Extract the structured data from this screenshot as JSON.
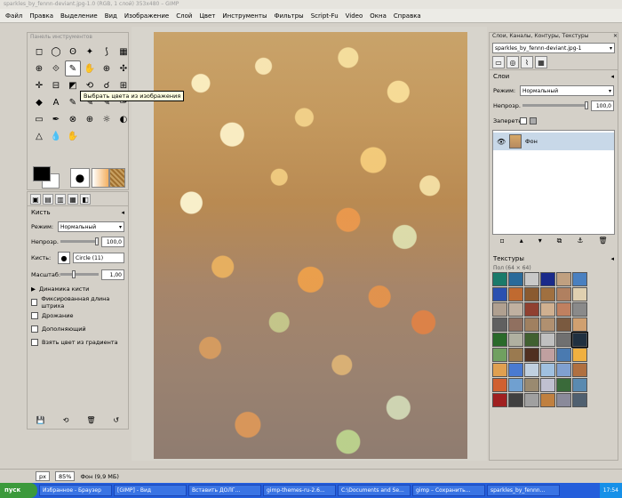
{
  "window": {
    "title": "sparkles_by_fennn-deviant.jpg-1.0 (RGB, 1 слой) 353x480 – GIMP"
  },
  "menu": [
    "Файл",
    "Правка",
    "Выделение",
    "Вид",
    "Изображение",
    "Слой",
    "Цвет",
    "Инструменты",
    "Фильтры",
    "Script-Fu",
    "Video",
    "Окна",
    "Справка"
  ],
  "toolbox": {
    "title": "Панель инструментов",
    "tooltip": "Выбрать цвета из изображения",
    "tool_icons": [
      "◻",
      "◯",
      "ʘ",
      "✦",
      "⟆",
      "▦",
      "⊕",
      "⟐",
      "✎",
      "✋",
      "⊕",
      "✣",
      "✛",
      "⊟",
      "◩",
      "⟲",
      "☌",
      "⊞",
      "◆",
      "A",
      "✎",
      "✎",
      "✎",
      "✑",
      "▭",
      "✒",
      "⊗",
      "⊕",
      "☼",
      "◐",
      "△",
      "💧",
      "✋",
      "",
      "",
      ""
    ],
    "active_index": 8
  },
  "tool_options": {
    "title": "Кисть",
    "mode_label": "Режим:",
    "mode_value": "Нормальный",
    "opacity_label": "Непрозр.",
    "opacity_value": "100,0",
    "brush_label": "Кисть:",
    "brush_value": "Circle (11)",
    "scale_label": "Масштаб:",
    "scale_value": "1,00",
    "dynamics_label": "Динамика кисти",
    "options": [
      "Фиксированная длина штриха",
      "Дрожание",
      "Дополняющий",
      "Взять цвет из градиента"
    ]
  },
  "right_dock": {
    "title": "Слои, Каналы, Контуры, Текстуры",
    "image_combo": "sparkles_by_fennn-deviant.jpg-1",
    "layers_title": "Слои",
    "mode_label": "Режим:",
    "mode_value": "Нормальный",
    "opacity_label": "Непрозр.",
    "opacity_value": "100,0",
    "lock_label": "Запереть:",
    "layer_name": "Фон",
    "patterns_title": "Текстуры",
    "patterns_sub": "Пол (64 × 64)"
  },
  "statusbar": {
    "unit": "px",
    "zoom": "85%",
    "info": "Фон (9,9 МБ)"
  },
  "taskbar": {
    "start": "пуск",
    "tasks": [
      "Избранное - Браузер",
      "[GIMP] - Вид",
      "Вставить ДОЛГ...",
      "gimp-themes-ru-2.6...",
      "C:\\Documents and Se...",
      "gimp – Сохранить...",
      "sparkles_by_fennn..."
    ],
    "clock": "17:54"
  },
  "texture_colors": [
    "#1a7a6a",
    "#2a6a9a",
    "#c8c8c8",
    "#1a2a8a",
    "#c0a080",
    "#4a80c0",
    "#2a50b0",
    "#c06a30",
    "#8a5a30",
    "#a07040",
    "#b08060",
    "#e0d0b0",
    "#b0a090",
    "#c0b0a0",
    "#904030",
    "#d0b090",
    "#c08060",
    "#8a8a8a",
    "#606060",
    "#907060",
    "#a08060",
    "#b09070",
    "#7a5a40",
    "#d0a070",
    "#2a6a2a",
    "#b0b0a0",
    "#406030",
    "#c0c0c0",
    "#707070",
    "#203040",
    "#70a060",
    "#9a7a50",
    "#503020",
    "#c0a0a0",
    "#4a7ab0",
    "#f0b040",
    "#e0a050",
    "#4a7ad0",
    "#c0d0e0",
    "#a0c0e0",
    "#80a0d0",
    "#b07040",
    "#d06030",
    "#70a0d0",
    "#9a8a70",
    "#c0c0d0",
    "#3a6a3a",
    "#5a8ab0",
    "#a02020",
    "#404040",
    "#a0a0a0",
    "#c08040",
    "#8a8a9a",
    "#506070"
  ]
}
